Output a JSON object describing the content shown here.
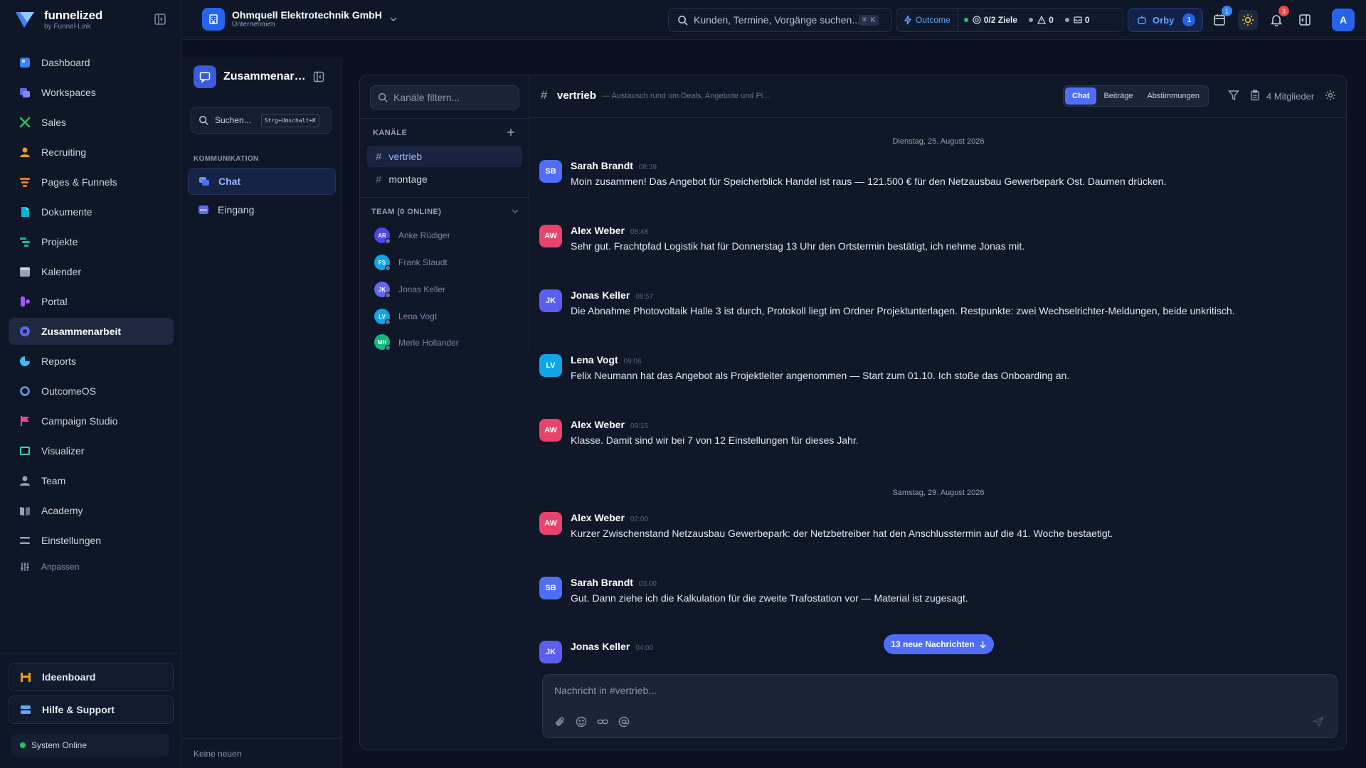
{
  "brand": {
    "name": "funnelized",
    "sub": "by Funnel-Link"
  },
  "nav": {
    "items": [
      {
        "label": "Dashboard",
        "icon": "dashboard-icon",
        "color": "#3b82f6"
      },
      {
        "label": "Workspaces",
        "icon": "workspaces-icon",
        "color": "#6366f1"
      },
      {
        "label": "Sales",
        "icon": "sales-icon",
        "color": "#22c55e"
      },
      {
        "label": "Recruiting",
        "icon": "recruiting-icon",
        "color": "#f59e0b"
      },
      {
        "label": "Pages & Funnels",
        "icon": "funnel-icon",
        "color": "#f97316"
      },
      {
        "label": "Dokumente",
        "icon": "documents-icon",
        "color": "#06b6d4"
      },
      {
        "label": "Projekte",
        "icon": "projects-icon",
        "color": "#14b8a6"
      },
      {
        "label": "Kalender",
        "icon": "calendar-icon",
        "color": "#94a3b8"
      },
      {
        "label": "Portal",
        "icon": "portal-icon",
        "color": "#a855f7"
      },
      {
        "label": "Zusammenarbeit",
        "icon": "collaboration-icon",
        "color": "#6366f1"
      },
      {
        "label": "Reports",
        "icon": "reports-icon",
        "color": "#38bdf8"
      },
      {
        "label": "OutcomeOS",
        "icon": "outcome-icon",
        "color": "#60a5fa"
      },
      {
        "label": "Campaign Studio",
        "icon": "campaign-flag-icon",
        "color": "#ec4899"
      },
      {
        "label": "Visualizer",
        "icon": "visualizer-icon",
        "color": "#2dd4bf"
      },
      {
        "label": "Team",
        "icon": "team-icon",
        "color": "#94a3b8"
      },
      {
        "label": "Academy",
        "icon": "academy-icon",
        "color": "#94a3b8"
      },
      {
        "label": "Einstellungen",
        "icon": "settings-icon",
        "color": "#94a3b8"
      }
    ],
    "customize": "Anpassen",
    "ideaboard": "Ideenboard",
    "help": "Hilfe & Support",
    "system_status": "System Online"
  },
  "topbar": {
    "company_name": "Ohmquell Elektrotechnik GmbH",
    "company_type": "Unternehmen",
    "search_placeholder": "Kunden, Termine, Vorgänge suchen...",
    "search_shortcut": "⌘ K",
    "outcome_label": "Outcome",
    "goals": "0/2 Ziele",
    "warnings": "0",
    "messages": "0",
    "orby_label": "Orby",
    "orby_count": "1",
    "calendar_badge": "1",
    "notifications_badge": "3",
    "user_initial": "A"
  },
  "subsidebar": {
    "title": "Zusammenarbeit",
    "search_label": "Suchen...",
    "search_shortcut": "Strg+Umschalt+K",
    "section": "KOMMUNIKATION",
    "items": [
      {
        "label": "Chat"
      },
      {
        "label": "Eingang"
      }
    ],
    "footer": "Keine neuen"
  },
  "channels": {
    "filter_placeholder": "Kanäle filtern...",
    "section_label": "KANÄLE",
    "list": [
      {
        "name": "vertrieb"
      },
      {
        "name": "montage"
      }
    ],
    "team_label": "TEAM (0 ONLINE)",
    "members": [
      {
        "initials": "AR",
        "name": "Anke Rüdiger",
        "color": "#4f46e5"
      },
      {
        "initials": "FS",
        "name": "Frank Staudt",
        "color": "#0ea5e9"
      },
      {
        "initials": "JK",
        "name": "Jonas Keller",
        "color": "#6366f1"
      },
      {
        "initials": "LV",
        "name": "Lena Vogt",
        "color": "#0ea5e9"
      },
      {
        "initials": "MH",
        "name": "Merle Hollander",
        "color": "#10b981"
      }
    ]
  },
  "chat": {
    "channel": "vertrieb",
    "description": "— Austausch rund um Deals, Angebote und Pi...",
    "tabs": [
      "Chat",
      "Beiträge",
      "Abstimmungen"
    ],
    "members_count": "4 Mitglieder",
    "dates": [
      "Dienstag, 25. August 2026",
      "Samstag, 29. August 2026"
    ],
    "messages": [
      {
        "initials": "SB",
        "author": "Sarah Brandt",
        "time": "08:39",
        "color": "#4f6ef7",
        "text": "Moin zusammen! Das Angebot für Speicherblick Handel ist raus — 121.500 € für den Netzausbau Gewerbepark Ost. Daumen drücken."
      },
      {
        "initials": "AW",
        "author": "Alex Weber",
        "time": "08:48",
        "color": "#e8436b",
        "text": "Sehr gut. Frachtpfad Logistik hat für Donnerstag 13 Uhr den Ortstermin bestätigt, ich nehme Jonas mit."
      },
      {
        "initials": "JK",
        "author": "Jonas Keller",
        "time": "08:57",
        "color": "#5b5ef0",
        "text": "Die Abnahme Photovoltaik Halle 3 ist durch, Protokoll liegt im Ordner Projektunterlagen. Restpunkte: zwei Wechselrichter-Meldungen, beide unkritisch."
      },
      {
        "initials": "LV",
        "author": "Lena Vogt",
        "time": "09:06",
        "color": "#0ea5e9",
        "text": "Felix Neumann hat das Angebot als Projektleiter angenommen — Start zum 01.10. Ich stoße das Onboarding an."
      },
      {
        "initials": "AW",
        "author": "Alex Weber",
        "time": "09:15",
        "color": "#e8436b",
        "text": "Klasse. Damit sind wir bei 7 von 12 Einstellungen für dieses Jahr."
      },
      {
        "initials": "AW",
        "author": "Alex Weber",
        "time": "02:00",
        "color": "#e8436b",
        "text": "Kurzer Zwischenstand Netzausbau Gewerbepark: der Netzbetreiber hat den Anschlusstermin auf die 41. Woche bestaetigt."
      },
      {
        "initials": "SB",
        "author": "Sarah Brandt",
        "time": "03:00",
        "color": "#4f6ef7",
        "text": "Gut. Dann ziehe ich die Kalkulation für die zweite Trafostation vor — Material ist zugesagt."
      },
      {
        "initials": "JK",
        "author": "Jonas Keller",
        "time": "04:00",
        "color": "#5b5ef0",
        "text": ""
      }
    ],
    "new_messages": "13 neue Nachrichten",
    "composer_placeholder": "Nachricht in #vertrieb..."
  }
}
